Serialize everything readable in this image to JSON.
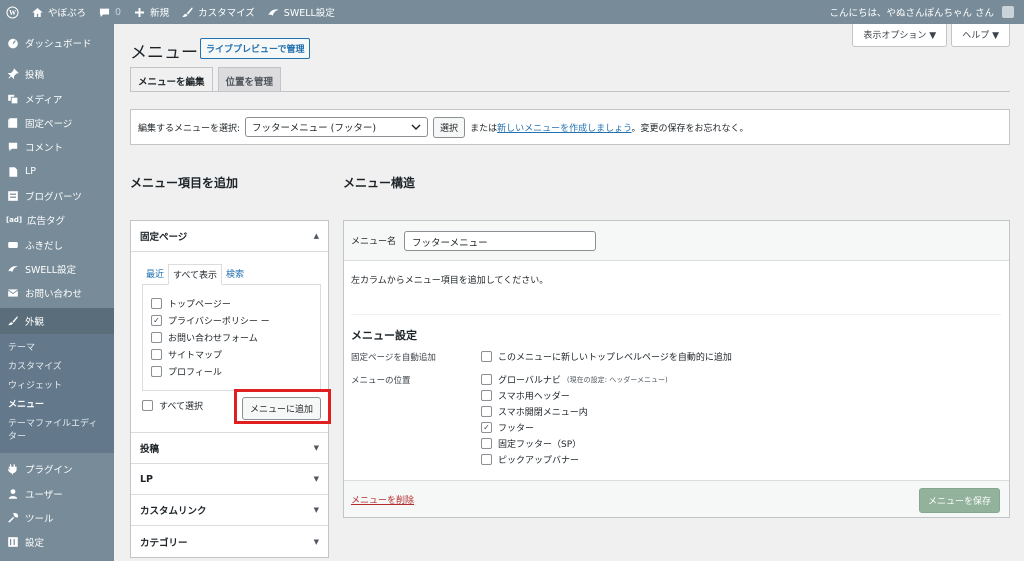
{
  "adminbar": {
    "site_name": "やぼぷろ",
    "comments_count": "0",
    "new_label": "新規",
    "customize_label": "カスタマイズ",
    "swell_label": "SWELL設定",
    "greeting": "こんにちは、やぬさんぽんちゃん さん"
  },
  "sidebar": {
    "items": [
      {
        "label": "ダッシュボード",
        "icon": "dashboard-icon"
      },
      {
        "label": "投稿",
        "icon": "pin-icon"
      },
      {
        "label": "メディア",
        "icon": "media-icon"
      },
      {
        "label": "固定ページ",
        "icon": "page-icon"
      },
      {
        "label": "コメント",
        "icon": "comment-icon"
      },
      {
        "label": "LP",
        "icon": "document-icon"
      },
      {
        "label": "ブログパーツ",
        "icon": "parts-icon"
      },
      {
        "label": "広告タグ",
        "icon": "ad-icon"
      },
      {
        "label": "ふきだし",
        "icon": "bubble-icon"
      },
      {
        "label": "SWELL設定",
        "icon": "swell-icon"
      },
      {
        "label": "お問い合わせ",
        "icon": "mail-icon"
      }
    ],
    "current": {
      "label": "外観",
      "icon": "appearance-icon"
    },
    "submenu": [
      "テーマ",
      "カスタマイズ",
      "ウィジェット",
      "メニュー",
      "テーマファイルエディター"
    ],
    "after": [
      {
        "label": "プラグイン",
        "icon": "plugin-icon"
      },
      {
        "label": "ユーザー",
        "icon": "user-icon"
      },
      {
        "label": "ツール",
        "icon": "tool-icon"
      },
      {
        "label": "設定",
        "icon": "settings-icon"
      }
    ]
  },
  "screen_options": {
    "display": "表示オプション ▼",
    "help": "ヘルプ ▼"
  },
  "page": {
    "title": "メニュー",
    "live_preview": "ライブプレビューで管理",
    "tabs": [
      "メニューを編集",
      "位置を管理"
    ]
  },
  "select_bar": {
    "label": "編集するメニューを選択:",
    "selected": "フッターメニュー (フッター)",
    "select_button": "選択",
    "or_text": "または",
    "create_link": "新しいメニューを作成しましょう",
    "save_note": "。変更の保存をお忘れなく。"
  },
  "add_items": {
    "heading": "メニュー項目を追加",
    "section_title": "固定ページ",
    "mini_tabs": [
      "最近",
      "すべて表示",
      "検索"
    ],
    "pages": [
      {
        "label": "トップページー",
        "checked": false
      },
      {
        "label": "プライバシーポリシー ー",
        "checked": true
      },
      {
        "label": "お問い合わせフォーム",
        "checked": false
      },
      {
        "label": "サイトマップ",
        "checked": false
      },
      {
        "label": "プロフィール",
        "checked": false
      }
    ],
    "select_all": "すべて選択",
    "add_button": "メニューに追加",
    "collapsed": [
      "投稿",
      "LP",
      "カスタムリンク",
      "カテゴリー"
    ]
  },
  "structure": {
    "heading": "メニュー構造",
    "name_label": "メニュー名",
    "name_value": "フッターメニュー",
    "hint": "左カラムからメニュー項目を追加してください。",
    "settings_title": "メニュー設定",
    "auto_add_label": "固定ページを自動追加",
    "auto_add_option": "このメニューに新しいトップレベルページを自動的に追加",
    "location_label": "メニューの位置",
    "locations": [
      {
        "label": "グローバルナビ",
        "note": "(現在の設定: ヘッダーメニュー)",
        "checked": false
      },
      {
        "label": "スマホ用ヘッダー",
        "note": "",
        "checked": false
      },
      {
        "label": "スマホ開閉メニュー内",
        "note": "",
        "checked": false
      },
      {
        "label": "フッター",
        "note": "",
        "checked": true
      },
      {
        "label": "固定フッター（SP）",
        "note": "",
        "checked": false
      },
      {
        "label": "ピックアップバナー",
        "note": "",
        "checked": false
      }
    ],
    "delete_link": "メニューを削除",
    "save_button": "メニューを保存"
  }
}
